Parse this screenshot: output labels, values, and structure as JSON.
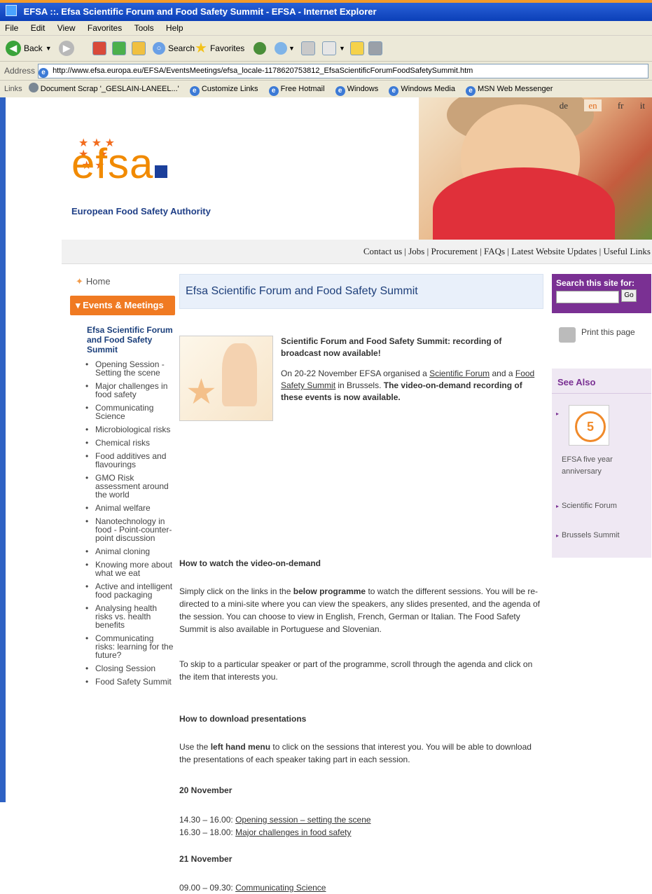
{
  "window": {
    "title": "EFSA ::. Efsa Scientific Forum and Food Safety Summit - EFSA - Internet Explorer",
    "menu": [
      "File",
      "Edit",
      "View",
      "Favorites",
      "Tools",
      "Help"
    ],
    "toolbar": {
      "back": "Back",
      "search": "Search",
      "favorites": "Favorites"
    },
    "address_label": "Address",
    "address_url": "http://www.efsa.europa.eu/EFSA/EventsMeetings/efsa_locale-1178620753812_EfsaScientificForumFoodSafetySummit.htm",
    "links_label": "Links",
    "links": [
      "Document Scrap '_GESLAIN-LANEEL...'",
      "Customize Links",
      "Free Hotmail",
      "Windows",
      "Windows Media",
      "MSN Web Messenger"
    ]
  },
  "site": {
    "languages": [
      "de",
      "en",
      "fr",
      "it"
    ],
    "active_language": "en",
    "logo_text": "efsa",
    "logo_subtitle": "European Food Safety Authority",
    "topnav": "Contact us | Jobs | Procurement | FAQs | Latest Website Updates | Useful Links"
  },
  "leftnav": {
    "home": "Home",
    "events": "Events & Meetings",
    "current": "Efsa Scientific Forum and Food Safety Summit",
    "items": [
      "Opening Session - Setting the scene",
      "Major challenges in food safety",
      "Communicating Science",
      "Microbiological risks",
      "Chemical risks",
      "Food additives and flavourings",
      "GMO Risk assessment around the world",
      "Animal welfare",
      "Nanotechnology in food - Point-counter-point discussion",
      "Animal cloning",
      "Knowing more about what we eat",
      "Active and intelligent food packaging",
      "Analysing health risks vs. health benefits",
      "Communicating risks: learning for the future?",
      "Closing Session",
      "Food Safety Summit"
    ]
  },
  "main": {
    "title": "Efsa Scientific Forum and Food Safety Summit",
    "intro_heading": "Scientific Forum and Food Safety Summit: recording of broadcast now available!",
    "intro_p1": "On 20-22 November EFSA organised a",
    "intro_link1": "Scientific Forum",
    "intro_and": "and a",
    "intro_link2": "Food Safety Summit",
    "intro_p2": "in Brussels.",
    "intro_bold": "The video-on-demand recording of these events is now available.",
    "how_watch_heading": "How to watch the video-on-demand",
    "how_watch_p1a": "Simply click on the links in the",
    "how_watch_p1b": "below programme",
    "how_watch_p1c": "to watch the different sessions. You will be re-directed to a mini-site where you can view the speakers, any slides presented, and the agenda of the session. You can choose to view in English, French, German or Italian. The Food Safety Summit is also available in Portuguese and Slovenian.",
    "how_watch_p2": "To skip to a particular speaker or part of the programme, scroll through the agenda and click on the item that interests you.",
    "how_download_heading": "How to download presentations",
    "how_download_a": "Use the",
    "how_download_b": "left hand menu",
    "how_download_c": "to click on the sessions that interest you. You will be able to download the presentations of each speaker taking part in each session.",
    "day1": "20 November",
    "day1_items": [
      {
        "time": "14.30 – 16.00:",
        "link": "Opening session – setting the scene"
      },
      {
        "time": "16.30 – 18.00:",
        "link": "Major challenges in food safety"
      }
    ],
    "day2": "21 November",
    "day2_items": [
      {
        "time": "09.00 – 09.30:",
        "link": "Communicating Science"
      }
    ]
  },
  "rightcol": {
    "search_label": "Search this site for:",
    "search_button": "Go",
    "print": "Print this page",
    "see_also": "See Also",
    "anniv_badge": "5",
    "anniv_label": "EFSA five year anniversary",
    "link1": "Scientific Forum",
    "link2": "Brussels Summit"
  },
  "colors": {
    "accent": "#f07a22",
    "purple": "#7a3093",
    "blue": "#1e3f7a"
  }
}
